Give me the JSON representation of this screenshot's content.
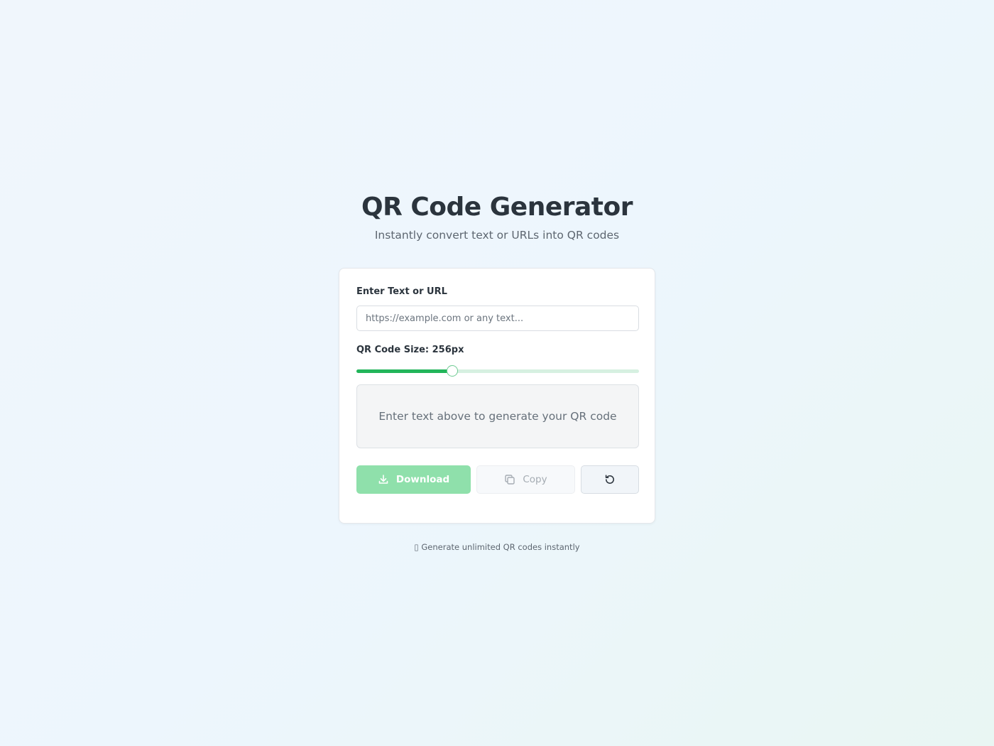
{
  "header": {
    "title": "QR Code Generator",
    "subtitle": "Instantly convert text or URLs into QR codes"
  },
  "form": {
    "input_label": "Enter Text or URL",
    "input_value": "",
    "input_placeholder": "https://example.com or any text...",
    "size_label": "QR Code Size: 256px",
    "size_value": 256,
    "size_fraction": 0.34
  },
  "preview": {
    "message": "Enter text above to generate your QR code"
  },
  "actions": {
    "download_label": "Download",
    "download_icon": "download-icon",
    "copy_label": "Copy",
    "copy_icon": "copy-icon",
    "reset_icon": "refresh-icon"
  },
  "footer": {
    "note": "▯ Generate unlimited QR codes instantly"
  },
  "colors": {
    "accent": "#22b55a",
    "accent_disabled": "#8fe0ab",
    "track": "#d6f0e1"
  }
}
